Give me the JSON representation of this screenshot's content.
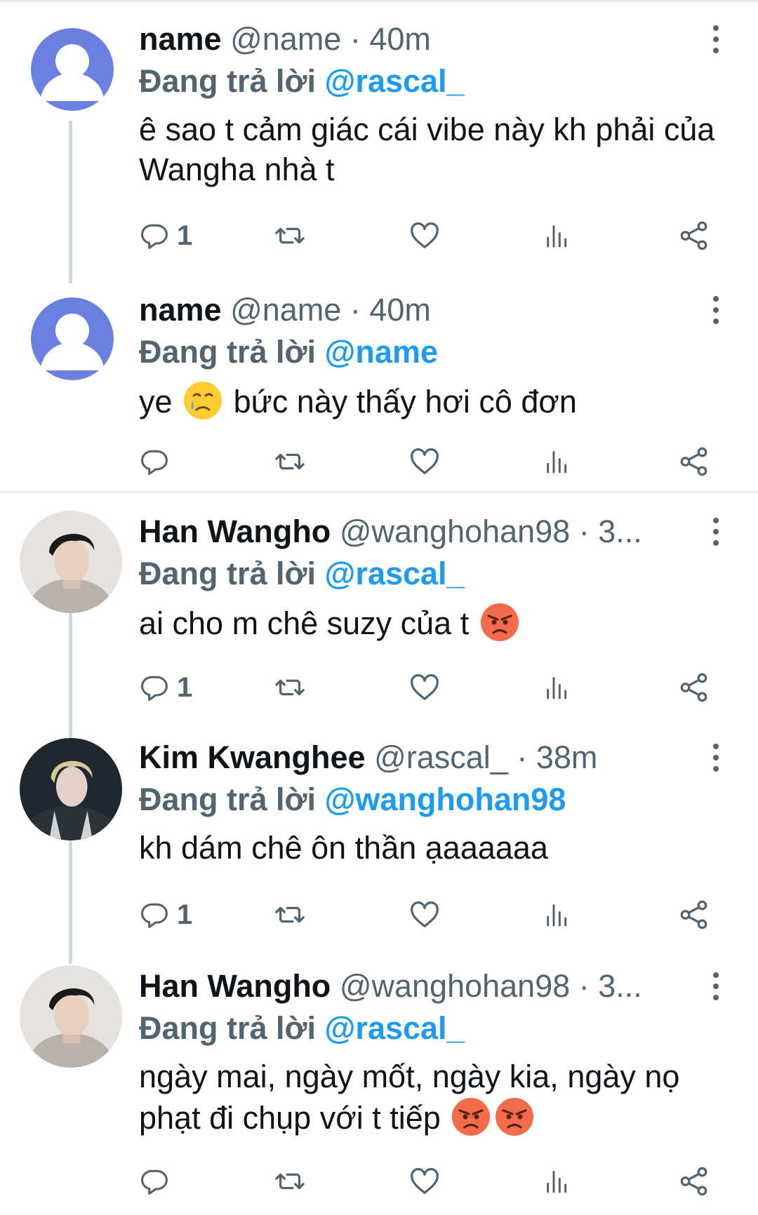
{
  "tweets": [
    {
      "name": "name",
      "handle": "@name",
      "time": "· 40m",
      "reply_prefix": "Đang trả lời",
      "reply_to": "@rascal_",
      "text": "ê sao t cảm giác cái vibe này kh phải của Wangha nhà t",
      "reply_count": "1",
      "avatar": "default-avatar"
    },
    {
      "name": "name",
      "handle": "@name",
      "time": "· 40m",
      "reply_prefix": "Đang trả lời",
      "reply_to": "@name",
      "text_before": "ye",
      "text_emoji": "crying-face-emoji",
      "text_after": "bức này thấy hơi cô đơn",
      "reply_count": "",
      "avatar": "default-avatar"
    },
    {
      "name": "Han Wangho",
      "handle": "@wanghohan98",
      "time": "· 3...",
      "reply_prefix": "Đang trả lời",
      "reply_to": "@rascal_",
      "text": "ai cho m chê suzy của t",
      "text_emoji": "angry-face-emoji",
      "reply_count": "1",
      "avatar": "photo-avatar-wanghohan98"
    },
    {
      "name": "Kim Kwanghee",
      "handle": "@rascal_",
      "time": "· 38m",
      "reply_prefix": "Đang trả lời",
      "reply_to": "@wanghohan98",
      "text": "kh dám chê ôn thần ạaaaaaa",
      "reply_count": "1",
      "avatar": "photo-avatar-rascal"
    },
    {
      "name": "Han Wangho",
      "handle": "@wanghohan98",
      "time": "· 3...",
      "reply_prefix": "Đang trả lời",
      "reply_to": "@rascal_",
      "text": "ngày mai, ngày mốt, ngày kia, ngày nọ phạt đi chụp với t tiếp",
      "text_emoji": "angry-face-emoji x2",
      "reply_count": "",
      "avatar": "photo-avatar-wanghohan98"
    }
  ],
  "colors": {
    "link": "#1d9bf0",
    "secondary": "#536471",
    "text": "#0f1419",
    "thread_line": "#cfd9de",
    "avatar_default": "#6b7fe0"
  },
  "icons": {
    "reply": "reply-icon",
    "retweet": "retweet-icon",
    "like": "heart-icon",
    "views": "analytics-icon",
    "share": "share-icon",
    "more": "more-vertical-icon"
  }
}
